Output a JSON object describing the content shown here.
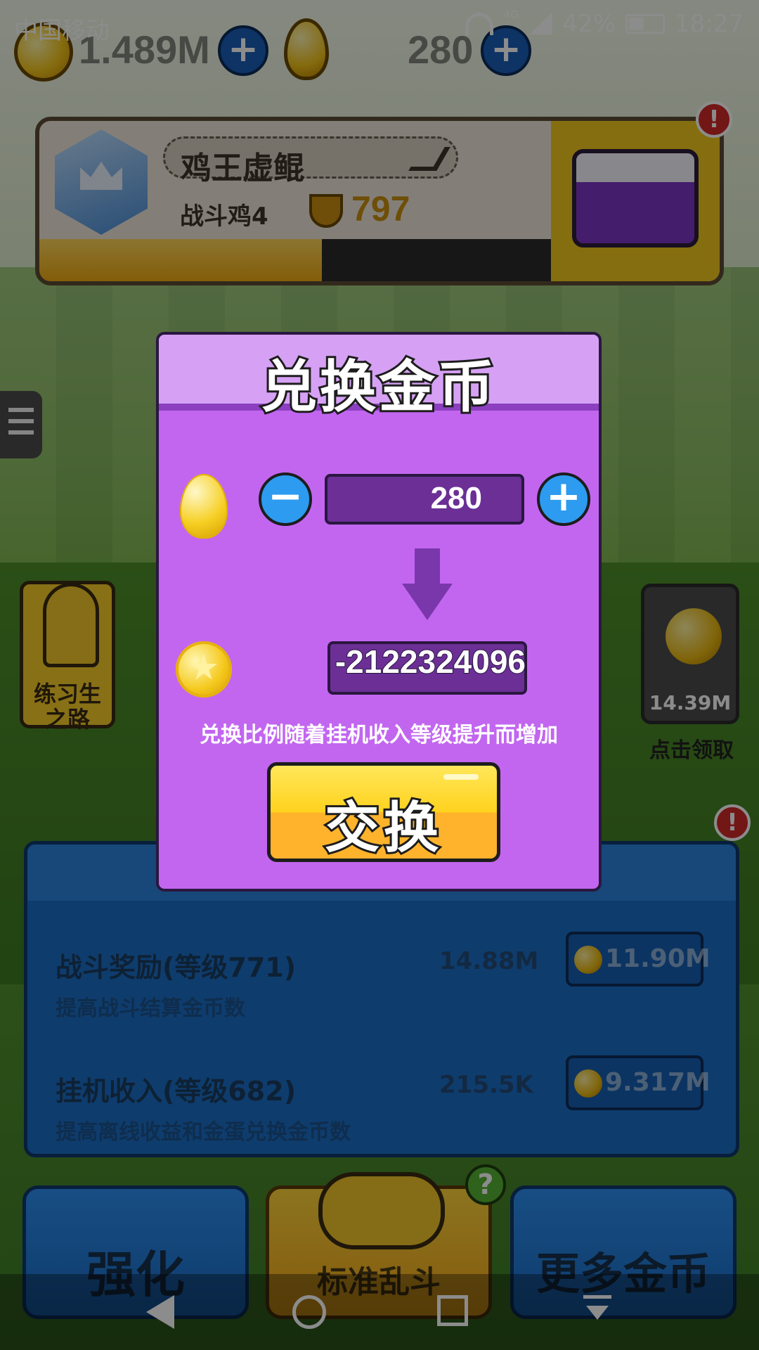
{
  "status_bar": {
    "carrier": "中国移动",
    "network": "4G",
    "battery": "42%",
    "time": "18:27"
  },
  "currency": {
    "gold": "1.489M",
    "eggs": "280"
  },
  "profile": {
    "name": "鸡王虚鲲",
    "rank": "战斗鸡4",
    "trophies": "797",
    "progress_fraction": 0.55
  },
  "side": {
    "left_label": "练习生之路",
    "right_value": "14.39M",
    "right_label": "点击领取"
  },
  "upgrades": [
    {
      "title": "战斗奖励(等级771)",
      "value": "14.88M",
      "cost": "11.90M",
      "desc": "提高战斗结算金币数"
    },
    {
      "title": "挂机收入(等级682)",
      "value": "215.5K",
      "cost": "9.317M",
      "desc": "提高离线收益和金蛋兑换金币数"
    }
  ],
  "bottom_buttons": {
    "strengthen": "强化",
    "standard_brawl": "标准乱斗",
    "more_coins": "更多金币"
  },
  "dialog": {
    "title": "兑换金币",
    "egg_amount": "280",
    "result": "-2122324096",
    "note": "兑换比例随着挂机收入等级提升而增加",
    "exchange_label": "交换",
    "minus_symbol": "−",
    "plus_symbol": "+"
  },
  "colors": {
    "dialog_bg": "#c266f0",
    "dialog_head": "#d6a1f4",
    "input_bg": "#6b2f96",
    "button_yellow": "#ffd21e",
    "round_btn": "#2d9bf0"
  }
}
